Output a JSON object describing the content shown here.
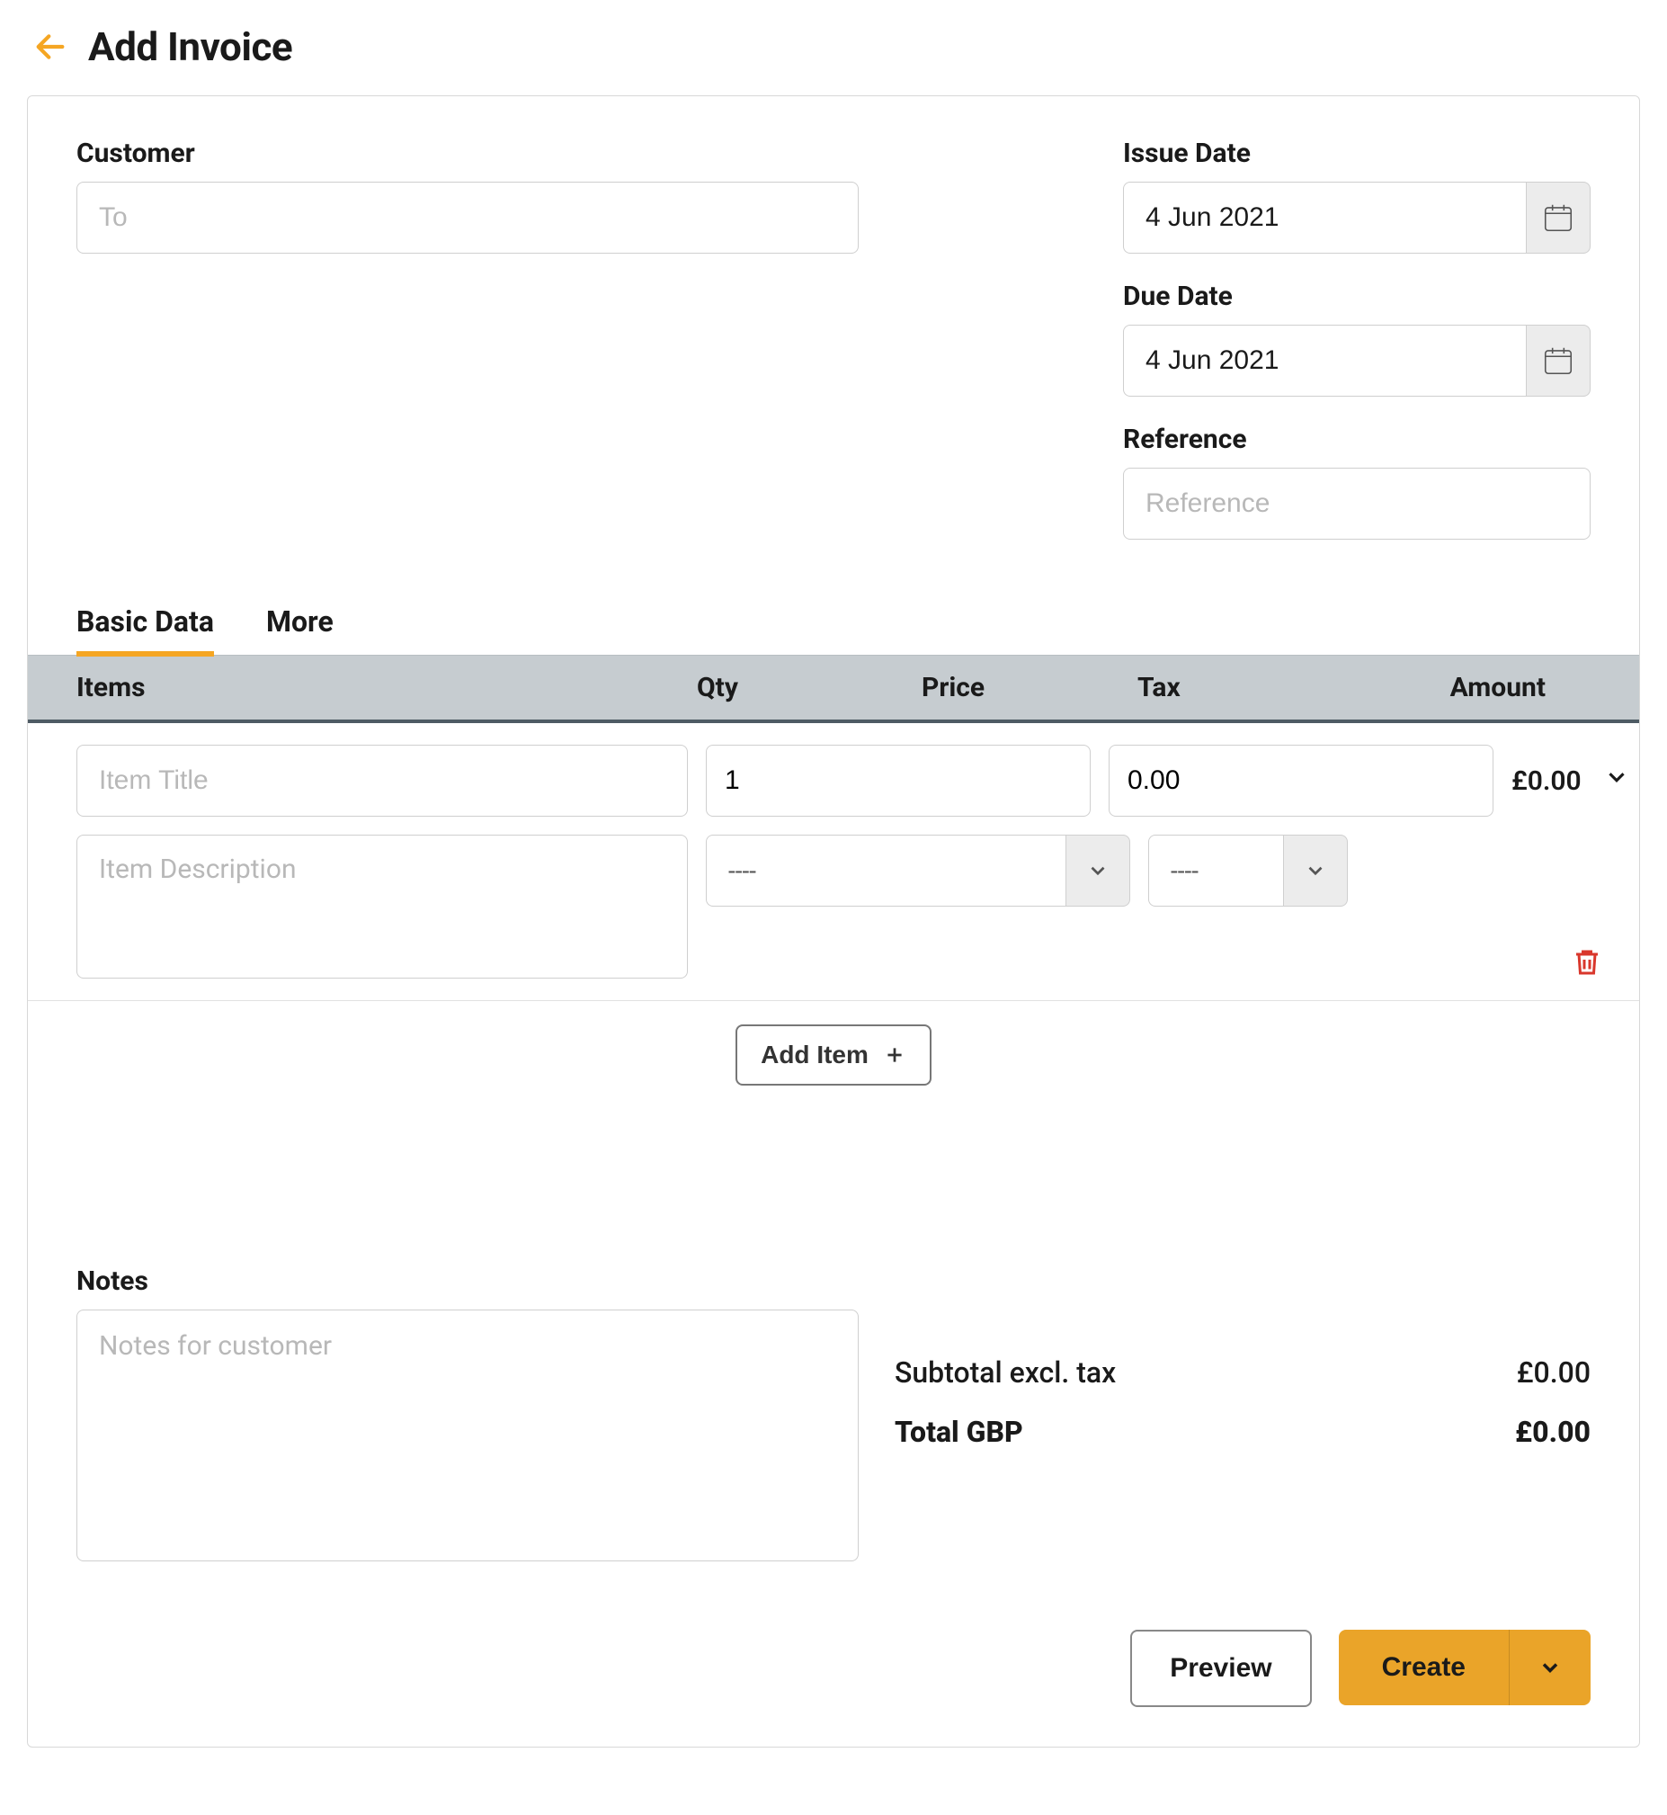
{
  "header": {
    "title": "Add Invoice"
  },
  "customer": {
    "label": "Customer",
    "placeholder": "To",
    "value": ""
  },
  "issue_date": {
    "label": "Issue Date",
    "value": "4 Jun 2021"
  },
  "due_date": {
    "label": "Due Date",
    "value": "4 Jun 2021"
  },
  "reference": {
    "label": "Reference",
    "placeholder": "Reference",
    "value": ""
  },
  "tabs": {
    "basic": "Basic Data",
    "more": "More"
  },
  "columns": {
    "items": "Items",
    "qty": "Qty",
    "price": "Price",
    "tax": "Tax",
    "amount": "Amount"
  },
  "line_item": {
    "title_placeholder": "Item Title",
    "title_value": "",
    "qty_value": "1",
    "price_value": "0.00",
    "amount": "£0.00",
    "desc_placeholder": "Item Description",
    "desc_value": "",
    "select1_value": "----",
    "select2_value": "----"
  },
  "add_item_label": "Add Item",
  "notes": {
    "label": "Notes",
    "placeholder": "Notes for customer",
    "value": ""
  },
  "totals": {
    "subtotal_label": "Subtotal excl. tax",
    "subtotal_value": "£0.00",
    "total_label": "Total GBP",
    "total_value": "£0.00"
  },
  "actions": {
    "preview": "Preview",
    "create": "Create"
  }
}
